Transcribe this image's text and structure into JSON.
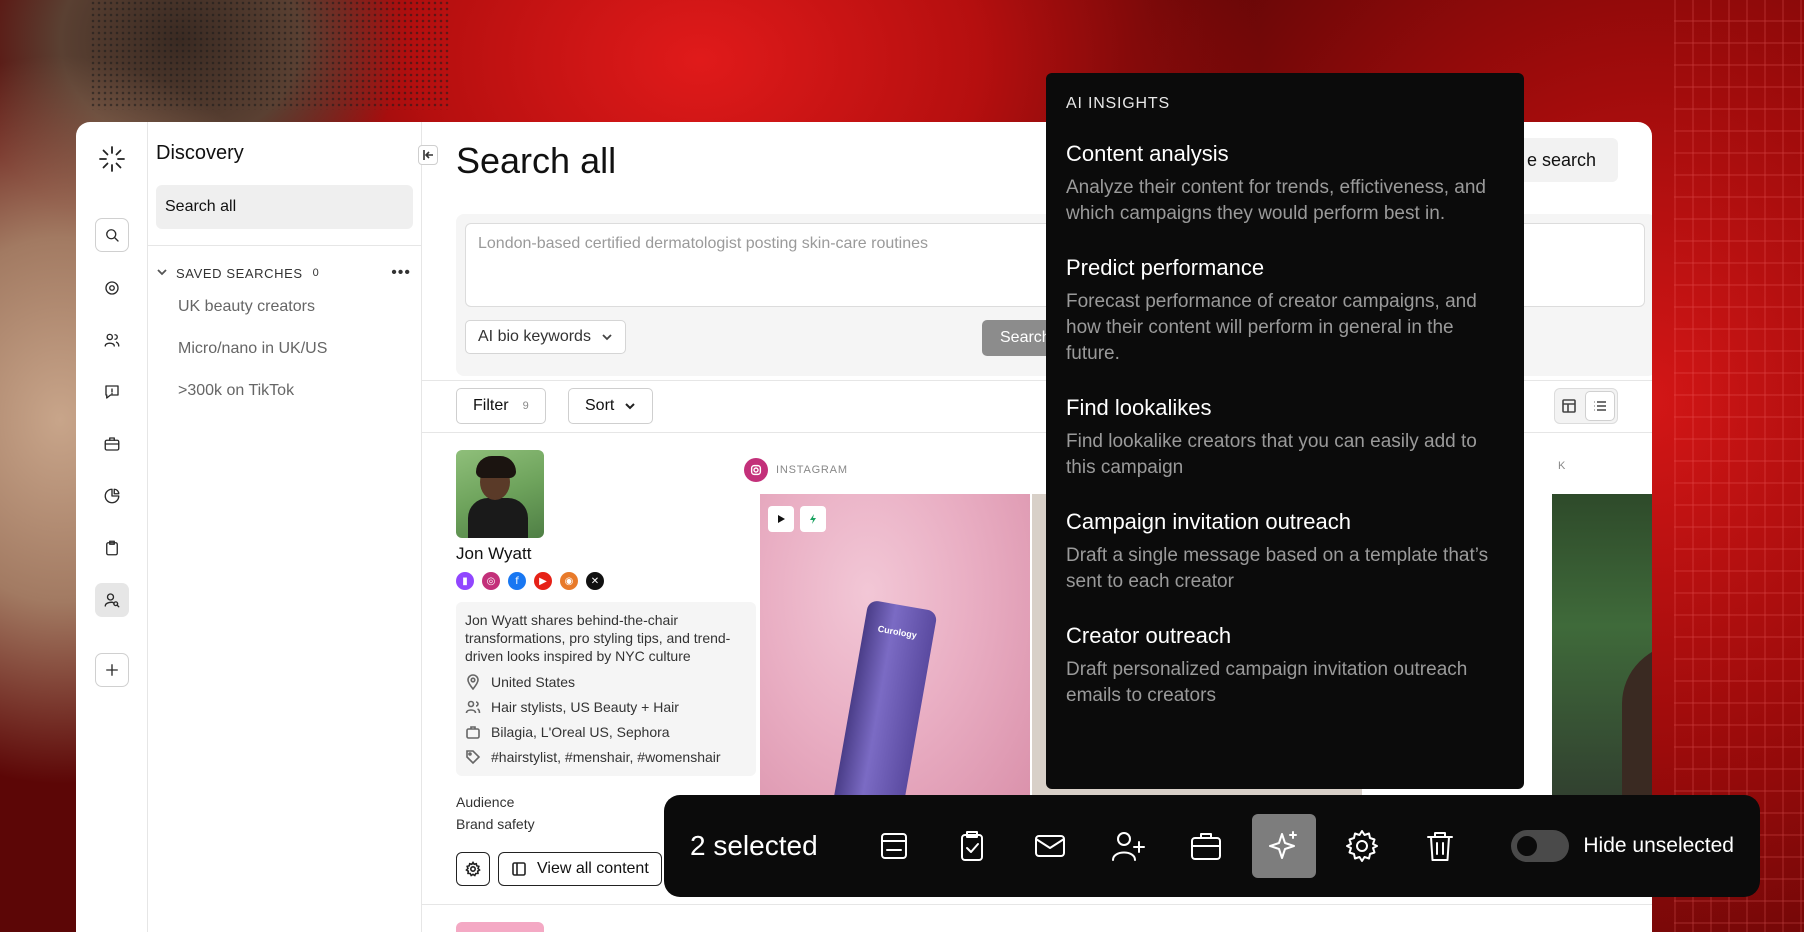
{
  "rail": {
    "items": [
      "search-icon",
      "target-icon",
      "users-icon",
      "chat-icon",
      "briefcase-icon",
      "pie-chart-icon",
      "clipboard-icon",
      "user-search-icon",
      "plus-icon"
    ]
  },
  "sidebar": {
    "title": "Discovery",
    "search_all": "Search all",
    "saved_searches": {
      "label": "SAVED SEARCHES",
      "count": "0",
      "items": [
        "UK beauty creators",
        "Micro/nano in UK/US",
        ">300k on TikTok"
      ]
    }
  },
  "main": {
    "title": "Search all",
    "save_search_label": "e search",
    "query_placeholder": "London-based certified dermatologist posting skin-care routines",
    "mode_label": "AI bio keywords",
    "search_label": "Search",
    "filter_label": "Filter",
    "filter_count": "9",
    "sort_label": "Sort"
  },
  "creator": {
    "name": "Jon Wyatt",
    "bio": "Jon Wyatt shares behind-the-chair transformations, pro styling tips, and trend-driven looks inspired by NYC culture",
    "location": "United States",
    "category": "Hair stylists, US Beauty + Hair",
    "brands": "Bilagia, L'Oreal US, Sephora",
    "tags": "#hairstylist, #menshair, #womenshair",
    "audience": "Audience",
    "brand_safety": "Brand safety",
    "view_content": "View all content",
    "platform_label": "INSTAGRAM",
    "product_text": "Curology",
    "tiktok_label": "K"
  },
  "insights": {
    "heading": "AI INSIGHTS",
    "items": [
      {
        "title": "Content analysis",
        "desc": "Analyze their content for trends, effictiveness, and which campaigns they would perform best in."
      },
      {
        "title": "Predict performance",
        "desc": "Forecast performance of creator campaigns, and how their content will perform in general in the future."
      },
      {
        "title": "Find lookalikes",
        "desc": "Find lookalike creators that you can easily add to this campaign"
      },
      {
        "title": "Campaign invitation outreach",
        "desc": "Draft a single message based on a template that’s sent to each creator"
      },
      {
        "title": "Creator outreach",
        "desc": "Draft personalized campaign invitation outreach emails to creators"
      }
    ]
  },
  "selection": {
    "count_label": "2 selected",
    "tools": [
      "panel-icon",
      "clipboard-check-icon",
      "mail-icon",
      "user-plus-icon",
      "briefcase-icon",
      "sparkle-icon",
      "gear-icon",
      "trash-icon"
    ],
    "active_tool": "sparkle-icon",
    "hide_label": "Hide unselected",
    "hide_enabled": false
  }
}
